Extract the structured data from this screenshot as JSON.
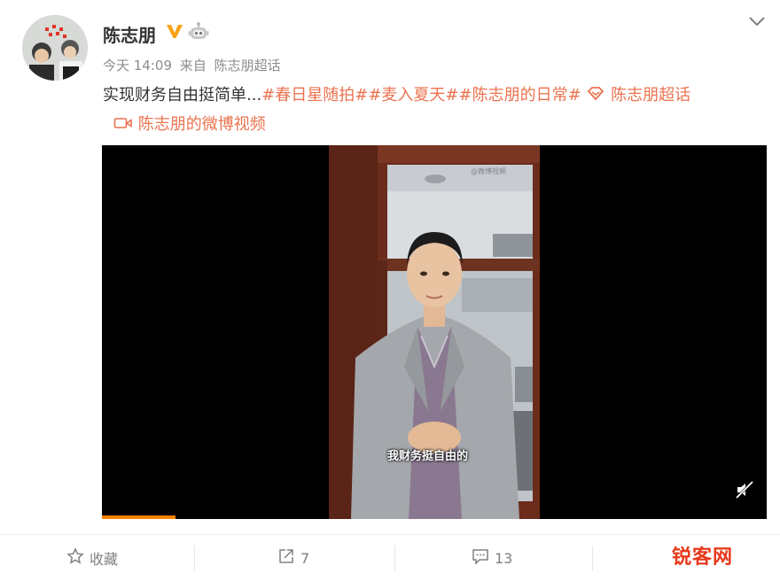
{
  "post": {
    "author": "陈志朋",
    "meta": {
      "time": "今天 14:09",
      "source_prefix": "来自",
      "source": "陈志朋超话"
    },
    "text": {
      "main": "实现财务自由挺简单...",
      "tags": "#春日星随拍##麦入夏天##陈志朋的日常#",
      "supertopic": "陈志朋超话"
    },
    "video_link": "陈志朋的微博视频"
  },
  "video": {
    "watermark": "@微博视频",
    "subtitle": "我财务挺自由的",
    "progress": 0.11
  },
  "actions": {
    "favorite_label": "收藏",
    "share_count": "7",
    "comment_count": "13"
  },
  "site_watermark": "锐客网",
  "colors": {
    "accent": "#eb7350",
    "verified": "#f9a316",
    "progress": "#ff8200"
  }
}
